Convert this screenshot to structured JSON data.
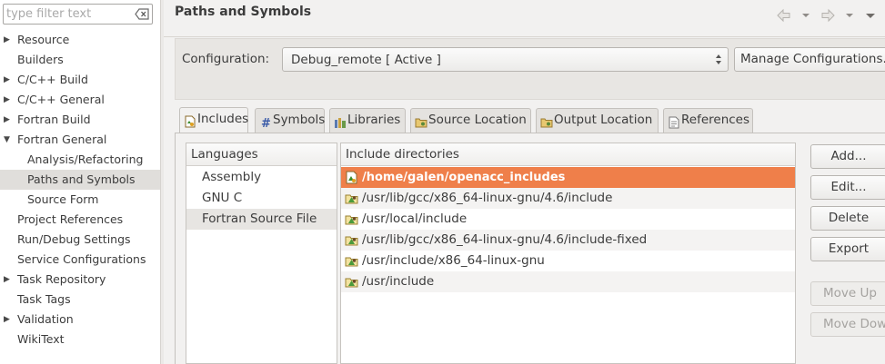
{
  "filter": {
    "placeholder": "type filter text",
    "clear_icon": "clear-filter-icon"
  },
  "tree": [
    {
      "label": "Resource",
      "expandable": true,
      "child": false,
      "selected": false
    },
    {
      "label": "Builders",
      "expandable": false,
      "child": false,
      "selected": false
    },
    {
      "label": "C/C++ Build",
      "expandable": true,
      "child": false,
      "selected": false
    },
    {
      "label": "C/C++ General",
      "expandable": true,
      "child": false,
      "selected": false
    },
    {
      "label": "Fortran Build",
      "expandable": true,
      "child": false,
      "selected": false
    },
    {
      "label": "Fortran General",
      "expandable": true,
      "expanded": true,
      "child": false,
      "selected": false
    },
    {
      "label": "Analysis/Refactoring",
      "expandable": false,
      "child": true,
      "selected": false
    },
    {
      "label": "Paths and Symbols",
      "expandable": false,
      "child": true,
      "selected": true
    },
    {
      "label": "Source Form",
      "expandable": false,
      "child": true,
      "selected": false
    },
    {
      "label": "Project References",
      "expandable": false,
      "child": false,
      "selected": false
    },
    {
      "label": "Run/Debug Settings",
      "expandable": false,
      "child": false,
      "selected": false
    },
    {
      "label": "Service Configurations",
      "expandable": false,
      "child": false,
      "selected": false
    },
    {
      "label": "Task Repository",
      "expandable": true,
      "child": false,
      "selected": false
    },
    {
      "label": "Task Tags",
      "expandable": false,
      "child": false,
      "selected": false
    },
    {
      "label": "Validation",
      "expandable": true,
      "child": false,
      "selected": false
    },
    {
      "label": "WikiText",
      "expandable": false,
      "child": false,
      "selected": false
    }
  ],
  "page": {
    "title": "Paths and Symbols"
  },
  "configuration": {
    "label": "Configuration:",
    "value": "Debug_remote  [ Active ]",
    "manage_label": "Manage Configurations..."
  },
  "tabs": [
    {
      "label": "Includes",
      "icon": "includes-icon",
      "active": true
    },
    {
      "label": "Symbols",
      "icon": "hash-icon",
      "active": false
    },
    {
      "label": "Libraries",
      "icon": "libraries-icon",
      "active": false
    },
    {
      "label": "Source Location",
      "icon": "folder-icon",
      "active": false
    },
    {
      "label": "Output Location",
      "icon": "folder-icon",
      "active": false
    },
    {
      "label": "References",
      "icon": "references-icon",
      "active": false
    }
  ],
  "languages": {
    "header": "Languages",
    "items": [
      {
        "label": "Assembly",
        "selected": false
      },
      {
        "label": "GNU C",
        "selected": false
      },
      {
        "label": "Fortran Source File",
        "selected": true
      }
    ]
  },
  "includes": {
    "header": "Include directories",
    "items": [
      {
        "path": "/home/galen/openacc_includes",
        "selected": true
      },
      {
        "path": "/usr/lib/gcc/x86_64-linux-gnu/4.6/include",
        "selected": false
      },
      {
        "path": "/usr/local/include",
        "selected": false
      },
      {
        "path": "/usr/lib/gcc/x86_64-linux-gnu/4.6/include-fixed",
        "selected": false
      },
      {
        "path": "/usr/include/x86_64-linux-gnu",
        "selected": false
      },
      {
        "path": "/usr/include",
        "selected": false
      }
    ]
  },
  "buttons": {
    "add": "Add...",
    "edit": "Edit...",
    "delete": "Delete",
    "export": "Export",
    "move_up": "Move Up",
    "move_down": "Move Down"
  },
  "colors": {
    "selection": "#ef7f4a",
    "background": "#f2f1f0"
  }
}
